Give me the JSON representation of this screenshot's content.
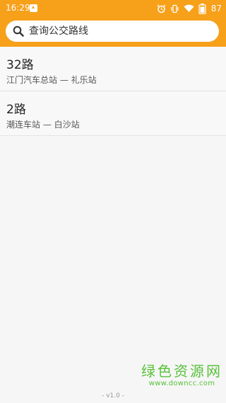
{
  "status_bar": {
    "time": "16:29",
    "battery_level": "87",
    "icons": [
      "notification-icon",
      "alarm-icon",
      "vibrate-icon",
      "wifi-icon",
      "battery-icon"
    ]
  },
  "header": {
    "accent_color": "#f7a01a",
    "search": {
      "placeholder": "查询公交路线",
      "value": ""
    }
  },
  "routes": [
    {
      "name": "32路",
      "stops": "江门汽车总站 — 礼乐站"
    },
    {
      "name": "2路",
      "stops": "潮连车站 — 白沙站"
    }
  ],
  "footer": {
    "version": "- v1.0 -"
  },
  "watermark": {
    "title": "绿色资源网",
    "url": "www.downcc.com",
    "color": "#58c23a"
  }
}
